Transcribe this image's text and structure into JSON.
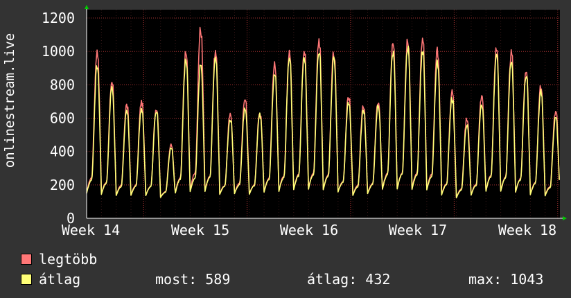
{
  "chart_data": {
    "type": "line",
    "ylabel": "onlinestream.live",
    "ylim": [
      0,
      1250
    ],
    "yticks": [
      0,
      200,
      400,
      600,
      800,
      1000,
      1200
    ],
    "x_ticks": [
      "Week 14",
      "Week 15",
      "Week 16",
      "Week 17",
      "Week 18"
    ],
    "grid": true,
    "series": [
      {
        "name": "legtöbb",
        "color": "#ff7777",
        "daily_peaks": [
          1000,
          820,
          680,
          700,
          660,
          440,
          990,
          1130,
          1000,
          620,
          720,
          640,
          920,
          990,
          1010,
          1070,
          990,
          730,
          680,
          700,
          1040,
          1080,
          1070,
          1010,
          760,
          600,
          730,
          1020,
          990,
          890,
          790,
          640
        ]
      },
      {
        "name": "átlag",
        "color": "#ffff77",
        "daily_peaks": [
          910,
          780,
          640,
          660,
          640,
          420,
          950,
          920,
          950,
          600,
          660,
          620,
          870,
          950,
          960,
          1000,
          950,
          700,
          640,
          670,
          1000,
          1030,
          1000,
          940,
          720,
          560,
          690,
          980,
          950,
          860,
          760,
          600
        ]
      }
    ],
    "daily_min": [
      110,
      110,
      110,
      110,
      110,
      110,
      110,
      120,
      120,
      120,
      120,
      120,
      120,
      120,
      130,
      130,
      130,
      130,
      110,
      120,
      130,
      130,
      130,
      130,
      110,
      100,
      110,
      120,
      120,
      120,
      110,
      110
    ]
  },
  "legend": [
    {
      "label": "legtöbb",
      "color": "#ff7777"
    },
    {
      "label": "átlag",
      "color": "#ffff77"
    }
  ],
  "stats": {
    "now": "most: 589",
    "avg": "átlag: 432",
    "max": "max: 1043"
  }
}
